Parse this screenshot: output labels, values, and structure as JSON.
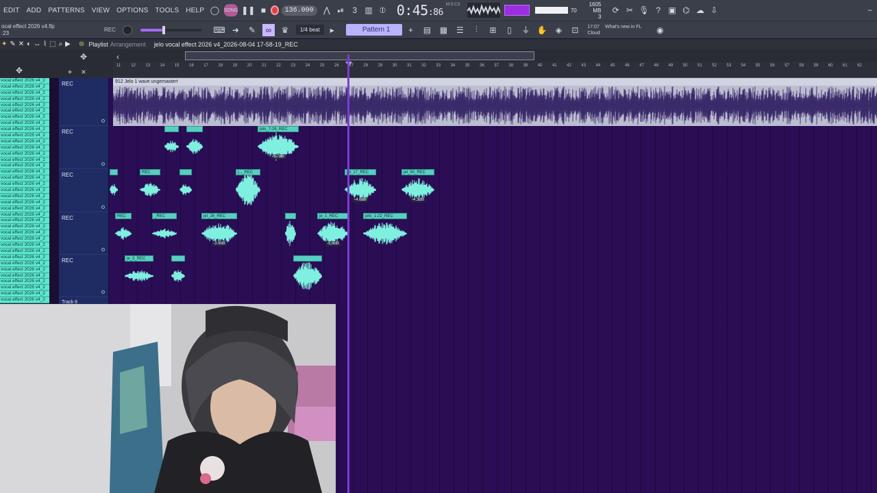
{
  "menu": [
    "EDIT",
    "ADD",
    "PATTERNS",
    "VIEW",
    "OPTIONS",
    "TOOLS",
    "HELP"
  ],
  "transport": {
    "tempo": "136.000",
    "time_main": "0:45",
    "time_sub": ":86",
    "time_format": "M:S:CS",
    "meter_value": "70",
    "ram_line1": "1605 MB",
    "ram_line2": "3",
    "cpu_level": 0.85
  },
  "project": {
    "name_line1": "ocal effect 2026 v4.flp",
    "name_line2": ":23",
    "rec_label": "REC"
  },
  "toolbar2": {
    "snap": "1/4 beat",
    "pattern": "Pattern 1"
  },
  "cloud": {
    "time": "17:07",
    "line1": "What's new in FL",
    "line2": "Cloud"
  },
  "playlist": {
    "title": "Playlist",
    "subtitle": "Arrangement",
    "file": "jelo vocal effect 2026 v4_2026-08-04 17-58-19_REC"
  },
  "ruler_ticks": [
    "11",
    "12",
    "13",
    "14",
    "15",
    "16",
    "17",
    "18",
    "19",
    "20",
    "21",
    "22",
    "23",
    "24",
    "25",
    "26",
    "27",
    "28",
    "29",
    "30",
    "31",
    "32",
    "33",
    "34",
    "35",
    "36",
    "37",
    "38",
    "39",
    "40",
    "41",
    "42",
    "43",
    "44",
    "45",
    "46",
    "47",
    "48",
    "49",
    "50",
    "51",
    "52",
    "53",
    "54",
    "55",
    "56",
    "57",
    "58",
    "59",
    "60",
    "61",
    "62"
  ],
  "channels": [
    "vocal effect 2026 v4_2",
    "vocal effect 2026 v4_2",
    "vocal effect 2026 v4_2",
    "vocal effect 2026 v4_2",
    "vocal effect 2026 v4_2",
    "vocal effect 2026 v4_2",
    "vocal effect 2026 v4_2",
    "vocal effect 2026 v4_2",
    "vocal effect 2026 v4_2",
    "vocal effect 2026 v4_2",
    "vocal effect 2026 v4_2",
    "vocal effect 2026 v4_2",
    "vocal effect 2026 v4_2",
    "vocal effect 2026 v4_2",
    "vocal effect 2026 v4_2",
    "vocal effect 2026 v4_2",
    "vocal effect 2026 v4_2",
    "vocal effect 2026 v4_2",
    "vocal effect 2026 v4_2",
    "vocal effect 2026 v4_2",
    "vocal effect 2026 v4_2",
    "vocal effect 2026 v4_2",
    "vocal effect 2026 v4_2",
    "vocal effect 2026 v4_2",
    "vocal effect 2026 v4_2",
    "vocal effect 2026 v4_2",
    "vocal effect 2026 v4_2",
    "vocal effect 2026 v4_2",
    "vocal effect 2026 v4_2",
    "vocal effect 2026 v4_2",
    "vocal effect 2026 v4_2",
    "vocal effect 2026 v4_2",
    "vocal effect 2026 v4_2",
    "vocal effect 2026 v4_2",
    "vocal effect 2026 v4_2",
    "vocal effect 2026 v4_2",
    "vocal effect 2026 v4_2"
  ],
  "tracks": [
    {
      "name": "REC"
    },
    {
      "name": "REC"
    },
    {
      "name": "REC"
    },
    {
      "name": "REC"
    },
    {
      "name": "REC"
    },
    {
      "name": "Track 6"
    }
  ],
  "big_clip": {
    "label": "912 Jelo 1 wave ungemastert"
  },
  "clips": [
    {
      "label": "",
      "gain": ""
    },
    {
      "label": "",
      "gain": ""
    },
    {
      "label": "jelo_7-26_REC",
      "gain": "-5.7dB"
    },
    {
      "label": "",
      "gain": ""
    },
    {
      "label": "REC",
      "gain": ""
    },
    {
      "label": "",
      "gain": ""
    },
    {
      "label": "j..._REC",
      "gain": ""
    },
    {
      "label": "jel_17_REC",
      "gain": "-4.0dB"
    },
    {
      "label": "jel_50_REC",
      "gain": "-4.3dB"
    },
    {
      "label": "REC",
      "gain": ""
    },
    {
      "label": "_REC",
      "gain": ""
    },
    {
      "label": "jel_26_REC",
      "gain": "-3.9dB"
    },
    {
      "label": "",
      "gain": ""
    },
    {
      "label": "je_1_REC",
      "gain": "-1.9dB"
    },
    {
      "label": "jelo_1-22_REC",
      "gain": ""
    },
    {
      "label": "je_3_REC",
      "gain": ""
    },
    {
      "label": "",
      "gain": ""
    },
    {
      "label": "",
      "gain": ""
    }
  ],
  "colors": {
    "playlist_bg": "#2a0d55",
    "clip": "#58cfc0",
    "channel": "#5ee6cf",
    "track_header": "#1f2b63",
    "accent": "#9b2fe0"
  }
}
